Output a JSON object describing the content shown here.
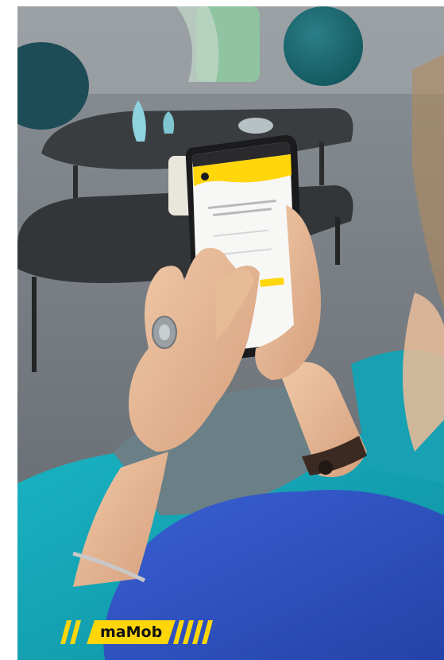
{
  "brand": {
    "logo_text": "maMob",
    "accent_color": "#ffd60a",
    "logo_text_color": "#111111"
  },
  "colors": {
    "sofa": "#1aa7b8",
    "sweater": "#2f55c8",
    "background": "#6f757b"
  }
}
